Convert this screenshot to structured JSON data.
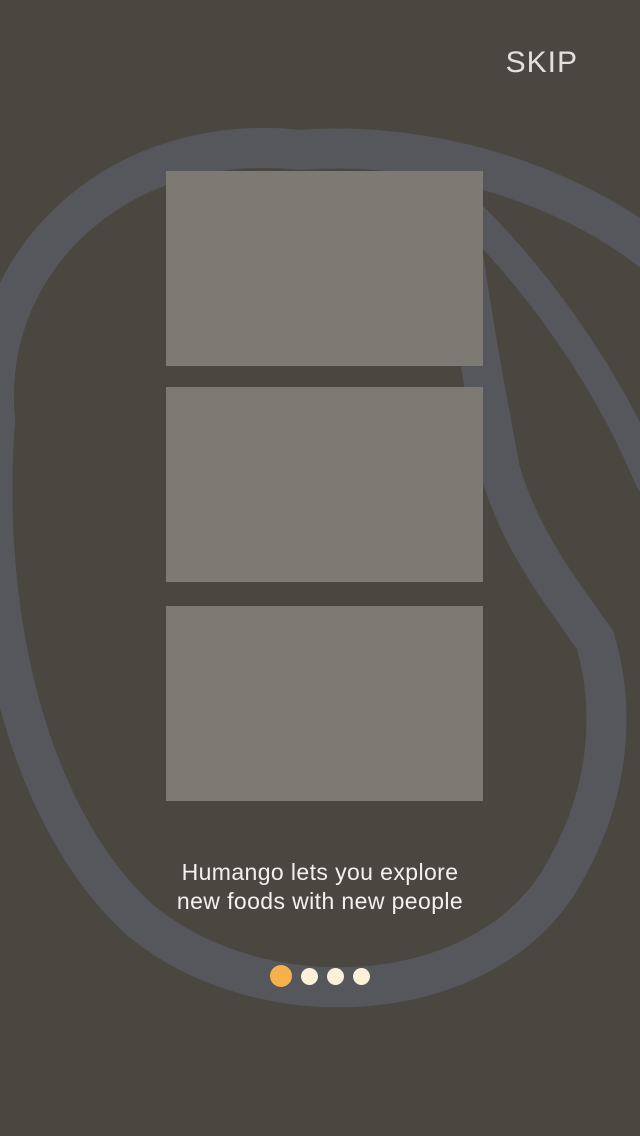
{
  "header": {
    "skip_label": "SKIP"
  },
  "onboarding": {
    "caption_line_1": "Humango lets you explore",
    "caption_line_2": "new foods with new people",
    "pages_total": 4,
    "current_page": 1
  },
  "colors": {
    "background": "#4a4740",
    "card": "#7d7a74",
    "dot_active": "#f6b04c",
    "dot_inactive": "#fbf0d8",
    "mark_stroke": "#55575c"
  },
  "icons": {
    "background_mark": "humango-mango-outline-icon"
  }
}
